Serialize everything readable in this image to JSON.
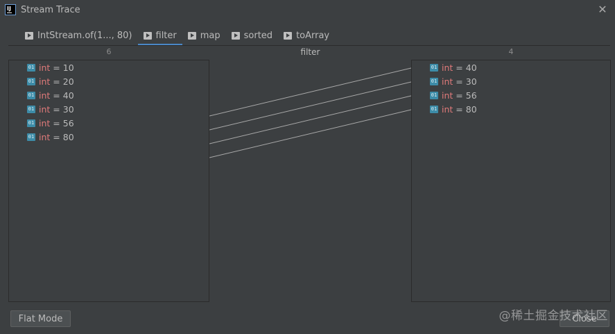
{
  "window": {
    "title": "Stream Trace",
    "icon": "intellij-icon",
    "close_icon": "close-icon"
  },
  "tabs": [
    {
      "label": "IntStream.of(1..., 80)",
      "active": false
    },
    {
      "label": "filter",
      "active": true
    },
    {
      "label": "map",
      "active": false
    },
    {
      "label": "sorted",
      "active": false
    },
    {
      "label": "toArray",
      "active": false
    }
  ],
  "columns": {
    "left_count": "6",
    "operation": "filter",
    "right_count": "4"
  },
  "left_items": [
    {
      "icon": "01",
      "type": "int",
      "text": "= 10"
    },
    {
      "icon": "01",
      "type": "int",
      "text": "= 20"
    },
    {
      "icon": "01",
      "type": "int",
      "text": "= 40"
    },
    {
      "icon": "01",
      "type": "int",
      "text": "= 30"
    },
    {
      "icon": "01",
      "type": "int",
      "text": "= 56"
    },
    {
      "icon": "01",
      "type": "int",
      "text": "= 80"
    }
  ],
  "right_items": [
    {
      "icon": "01",
      "type": "int",
      "text": "= 40"
    },
    {
      "icon": "01",
      "type": "int",
      "text": "= 30"
    },
    {
      "icon": "01",
      "type": "int",
      "text": "= 56"
    },
    {
      "icon": "01",
      "type": "int",
      "text": "= 80"
    }
  ],
  "mappings": [
    {
      "from": 2,
      "to": 0
    },
    {
      "from": 3,
      "to": 1
    },
    {
      "from": 4,
      "to": 2
    },
    {
      "from": 5,
      "to": 3
    }
  ],
  "buttons": {
    "flat_mode": "Flat Mode",
    "close": "Close"
  },
  "watermark": "@稀土掘金技术社区",
  "colors": {
    "accent": "#4a88c7",
    "keyword": "#e07a7a",
    "value_icon": "#3d8ca8"
  }
}
